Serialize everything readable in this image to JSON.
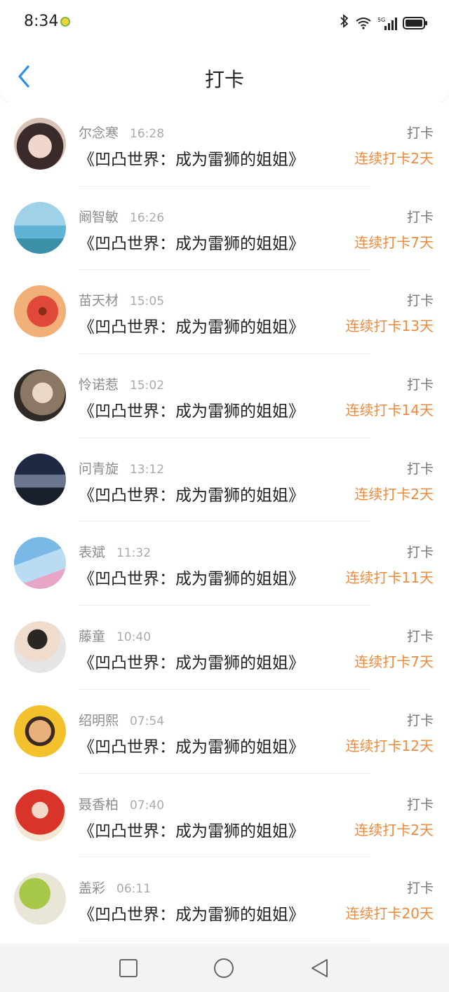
{
  "status": {
    "time": "8:34",
    "network": "5G"
  },
  "header": {
    "title": "打卡"
  },
  "rows": [
    {
      "name": "尔念寒",
      "time": "16:28",
      "book": "《凹凸世界：成为雷狮的姐姐》",
      "tag": "打卡",
      "streak": "连续打卡2天"
    },
    {
      "name": "阚智敏",
      "time": "16:26",
      "book": "《凹凸世界：成为雷狮的姐姐》",
      "tag": "打卡",
      "streak": "连续打卡7天"
    },
    {
      "name": "苗天材",
      "time": "15:05",
      "book": "《凹凸世界：成为雷狮的姐姐》",
      "tag": "打卡",
      "streak": "连续打卡13天"
    },
    {
      "name": "怜诺惹",
      "time": "15:02",
      "book": "《凹凸世界：成为雷狮的姐姐》",
      "tag": "打卡",
      "streak": "连续打卡14天"
    },
    {
      "name": "问青旋",
      "time": "13:12",
      "book": "《凹凸世界：成为雷狮的姐姐》",
      "tag": "打卡",
      "streak": "连续打卡2天"
    },
    {
      "name": "表斌",
      "time": "11:32",
      "book": "《凹凸世界：成为雷狮的姐姐》",
      "tag": "打卡",
      "streak": "连续打卡11天"
    },
    {
      "name": "藤童",
      "time": "10:40",
      "book": "《凹凸世界：成为雷狮的姐姐》",
      "tag": "打卡",
      "streak": "连续打卡7天"
    },
    {
      "name": "绍明熙",
      "time": "07:54",
      "book": "《凹凸世界：成为雷狮的姐姐》",
      "tag": "打卡",
      "streak": "连续打卡12天"
    },
    {
      "name": "聂香柏",
      "time": "07:40",
      "book": "《凹凸世界：成为雷狮的姐姐》",
      "tag": "打卡",
      "streak": "连续打卡2天"
    },
    {
      "name": "盖彩",
      "time": "06:11",
      "book": "《凹凸世界：成为雷狮的姐姐》",
      "tag": "打卡",
      "streak": "连续打卡20天"
    }
  ],
  "colors": {
    "accent": "#ee8a3c",
    "back": "#2e8de6"
  },
  "icons": [
    "back-icon",
    "bluetooth-icon",
    "wifi-icon",
    "signal-icon",
    "battery-icon",
    "home-square-icon",
    "home-circle-icon",
    "back-triangle-icon"
  ]
}
